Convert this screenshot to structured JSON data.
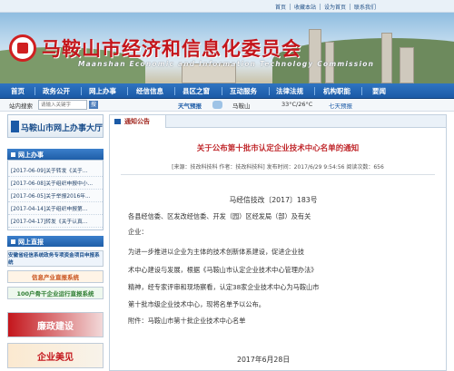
{
  "toplinks": {
    "home": "首页",
    "favorite": "收藏本站",
    "homepage": "设为首页",
    "contact": "联系我们"
  },
  "banner": {
    "title": "马鞍山市经济和信息化委员会",
    "subtitle": "Maanshan Economic and Information Technology Commission"
  },
  "nav": {
    "items": [
      "首页",
      "政务公开",
      "网上办事",
      "经信信息",
      "县区之窗",
      "互动服务",
      "法律法规",
      "机构职能",
      "要闻"
    ]
  },
  "search": {
    "label": "站内搜索",
    "placeholder": "请输入关键字",
    "button": "搜"
  },
  "weather": {
    "label": "天气预报",
    "city": "马鞍山",
    "temp": "33°C/26°C",
    "forecast": "七天预报"
  },
  "left": {
    "banner_title": "马鞍山市网上办事大厅",
    "online_title": "网上办事",
    "news": [
      "[2017-06-09]关于转发《关于...",
      "[2017-06-08]关于组织申报中小...",
      "[2017-06-05]关于举报2016年...",
      "[2017-04-14]关于组织申报第...",
      "[2017-04-17]转发《关于认真..."
    ],
    "direct_title": "网上直报",
    "promo1": "安徽省经信系统政务专项资金项目申报系统",
    "promo2": "信息产业直报系统",
    "promo3": "100户骨干企业运行直报系统",
    "promo4": "廉政建设",
    "promo5": "企业美见"
  },
  "main": {
    "tab": "通知公告",
    "title": "关于公布第十批市认定企业技术中心名单的通知",
    "meta": "[来源：技改科技科  作者：技改科技科]  发布时间：2017/6/29 9:54:56  阅读次数：656",
    "docnum": "马经信技改〔2017〕183号",
    "lines": [
      "各县经信委、区发改经信委、开发（园）区经发局（部）及有关",
      "企业：",
      "    为进一步推进以企业为主体的技术创新体系建设，促进企业技",
      "术中心建设与发展，根据《马鞍山市认定企业技术中心管理办法》",
      "精神，经专家评审和现场察看，认定38家企业技术中心为马鞍山市",
      "第十批市级企业技术中心，现将名单予以公布。",
      "    附件：马鞍山市第十批企业技术中心名单"
    ],
    "date": "2017年6月28日"
  }
}
